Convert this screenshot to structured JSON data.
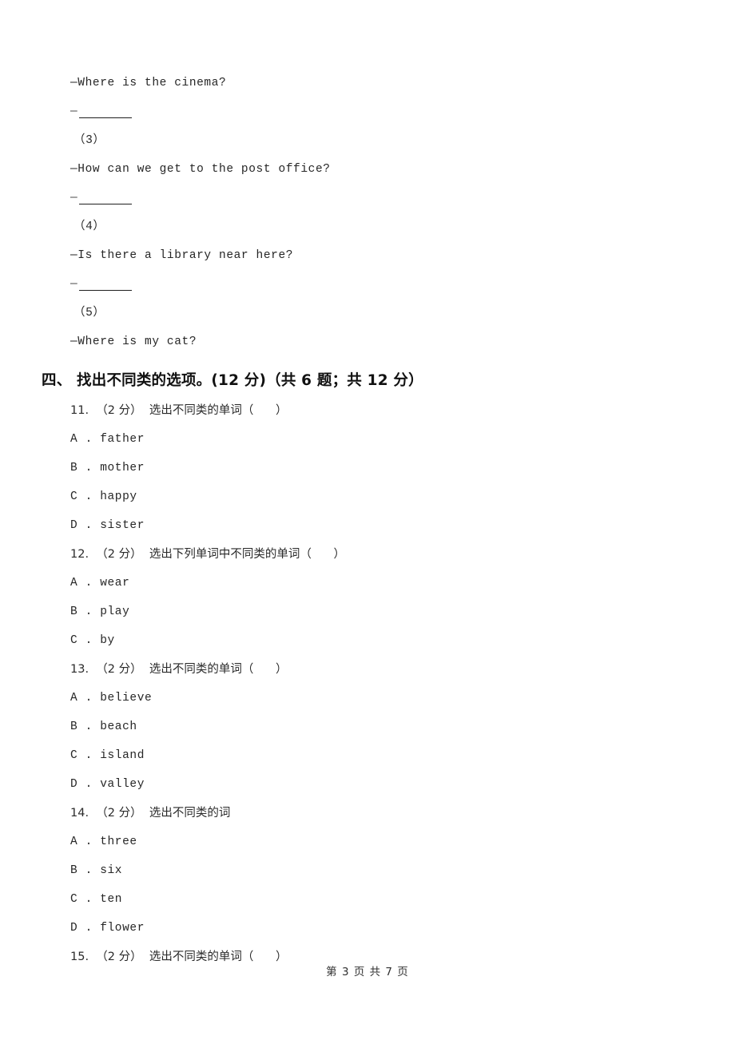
{
  "page": {
    "footer_text": "第 3 页 共 7 页"
  },
  "carryover": {
    "lines": [
      {
        "kind": "text",
        "value": "—Where is the cinema?"
      },
      {
        "kind": "blank",
        "dash": "—"
      },
      {
        "kind": "label",
        "value": "（3）"
      },
      {
        "kind": "text",
        "value": "—How can we get to the post office?"
      },
      {
        "kind": "blank",
        "dash": "—"
      },
      {
        "kind": "label",
        "value": "（4）"
      },
      {
        "kind": "text",
        "value": "—Is there a library near here?"
      },
      {
        "kind": "blank",
        "dash": "—"
      },
      {
        "kind": "label",
        "value": "（5）"
      },
      {
        "kind": "text",
        "value": "—Where is my cat?"
      }
    ]
  },
  "section": {
    "heading": "四、 找出不同类的选项。(12 分)（共 6 题；共 12 分）"
  },
  "questions": [
    {
      "stem": "11.  （2 分）  选出不同类的单词（      ）",
      "options": [
        "A . father",
        "B . mother",
        "C . happy",
        "D . sister"
      ]
    },
    {
      "stem": "12.  （2 分）  选出下列单词中不同类的单词（      ）",
      "options": [
        "A . wear",
        "B . play",
        "C . by"
      ]
    },
    {
      "stem": "13.  （2 分）  选出不同类的单词（      ）",
      "options": [
        "A . believe",
        "B . beach",
        "C . island",
        "D . valley"
      ]
    },
    {
      "stem": "14.  （2 分）  选出不同类的词",
      "options": [
        "A . three",
        "B . six",
        "C . ten",
        "D . flower"
      ]
    },
    {
      "stem": "15.  （2 分）  选出不同类的单词（      ）",
      "options": []
    }
  ]
}
